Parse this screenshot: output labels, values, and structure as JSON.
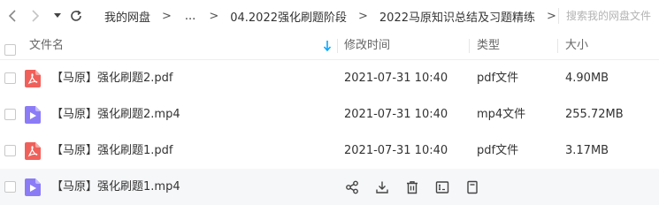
{
  "breadcrumb": [
    {
      "label": "我的网盘"
    },
    {
      "label": "..."
    },
    {
      "label": "04.2022强化刷题阶段"
    },
    {
      "label": "2022马原知识总结及习题精练"
    }
  ],
  "search": {
    "placeholder": "搜索我的网盘文件"
  },
  "columns": {
    "name": "文件名",
    "modified": "修改时间",
    "type": "类型",
    "size": "大小"
  },
  "files": [
    {
      "name": "【马原】强化刷题2.pdf",
      "modified": "2021-07-31 10:40",
      "type": "pdf文件",
      "size": "4.90MB",
      "icon": "pdf-file-icon"
    },
    {
      "name": "【马原】强化刷题2.mp4",
      "modified": "2021-07-31 10:40",
      "type": "mp4文件",
      "size": "255.72MB",
      "icon": "video-file-icon"
    },
    {
      "name": "【马原】强化刷题1.pdf",
      "modified": "2021-07-31 10:40",
      "type": "pdf文件",
      "size": "3.17MB",
      "icon": "pdf-file-icon"
    },
    {
      "name": "【马原】强化刷题1.mp4",
      "modified": "",
      "type": "",
      "size": "",
      "icon": "video-file-icon"
    }
  ],
  "row_actions": [
    "share-icon",
    "download-icon",
    "delete-icon",
    "rename-icon",
    "more-icon"
  ],
  "colors": {
    "pdf": "#f0605a",
    "video": "#8b7cf6",
    "accent": "#06a7ff"
  }
}
